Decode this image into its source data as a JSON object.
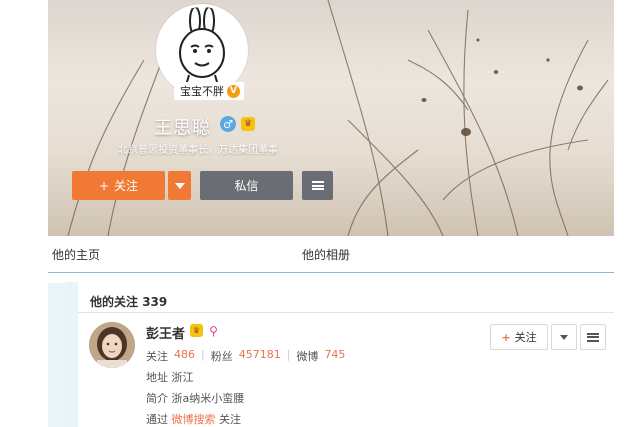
{
  "profile": {
    "nickname_tag": "宝宝不胖",
    "name": "王思聪",
    "description": "北京普思投资董事长，万达集团董事",
    "verified_mark": "V",
    "level_mark": "♛",
    "gender_mark": "♂",
    "buttons": {
      "follow_plus": "+",
      "follow": "关注",
      "message": "私信"
    }
  },
  "tabs": [
    {
      "label": "他的主页"
    },
    {
      "label": "他的相册"
    }
  ],
  "follow_list": {
    "title": "他的关注",
    "count": "339",
    "user": {
      "name": "彭王者",
      "level_mark": "♛",
      "gem_mark": "⚲",
      "follow_label": "关注",
      "follow_count": "486",
      "fans_label": "粉丝",
      "fans_count": "457181",
      "weibo_label": "微博",
      "weibo_count": "745",
      "address_label": "地址",
      "address_value": "浙江",
      "intro_label": "简介",
      "intro_value": "浙a纳米小蛮腰",
      "via_label": "通过",
      "via_link": "微博搜索",
      "via_suffix": "关注",
      "follow_button_plus": "+",
      "follow_button": "关注"
    }
  },
  "colors": {
    "accent_orange": "#f07a35",
    "dark_button": "#6a6d73",
    "link_orange": "#eb7350",
    "panel_blue": "#eaf5f9"
  }
}
